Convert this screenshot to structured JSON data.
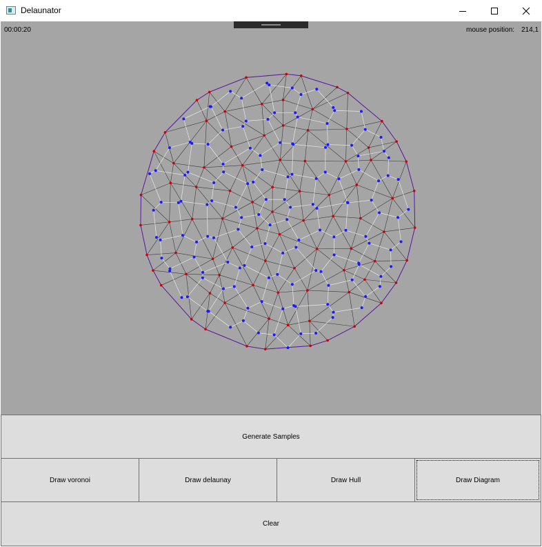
{
  "window": {
    "title": "Delaunator"
  },
  "status": {
    "timer": "00:00:20",
    "mouse_label": "mouse position:",
    "mouse_value": "214,1"
  },
  "buttons": {
    "generate": "Generate Samples",
    "voronoi": "Draw voronoi",
    "delaunay": "Draw delaunay",
    "hull": "Draw Hull",
    "diagram": "Draw Diagram",
    "clear": "Clear"
  },
  "colors": {
    "canvas_bg": "#a5a5a5",
    "sample_point": "#d00000",
    "voronoi_vertex": "#1a1aff",
    "delaunay_edge": "#3a3a3a",
    "voronoi_edge": "#e8e8e8",
    "hull_edge": "#5a1aa0"
  }
}
